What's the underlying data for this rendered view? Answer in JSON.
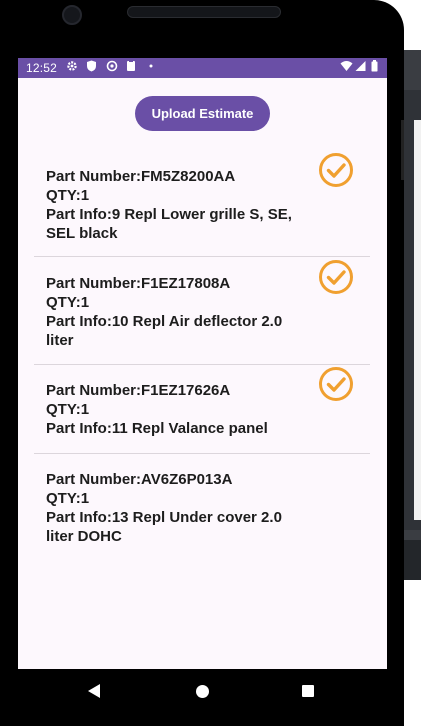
{
  "status_bar": {
    "time": "12:52",
    "icons": [
      "gear-icon",
      "shield-icon",
      "sync-icon",
      "clipboard-icon",
      "dot-icon",
      "wifi-icon",
      "signal-icon",
      "battery-icon"
    ]
  },
  "upload_button": {
    "label": "Upload Estimate"
  },
  "parts": [
    {
      "number_line": "Part Number:FM5Z8200AA",
      "qty_line": "QTY:1",
      "info_line": "Part Info:9 Repl Lower grille S, SE, SEL black",
      "checked": true
    },
    {
      "number_line": "Part Number:F1EZ17808A",
      "qty_line": "QTY:1",
      "info_line": "Part Info:10 Repl Air deflector 2.0 liter",
      "checked": true
    },
    {
      "number_line": "Part Number:F1EZ17626A",
      "qty_line": "QTY:1",
      "info_line": "Part Info:11 Repl Valance panel",
      "checked": true
    },
    {
      "number_line": "Part Number:AV6Z6P013A",
      "qty_line": "QTY:1",
      "info_line": "Part Info:13 Repl Under cover 2.0 liter DOHC",
      "checked": false
    }
  ],
  "colors": {
    "accent": "#6a4fa6",
    "check": "#f0a030",
    "screen_bg": "#fdf8fd"
  },
  "nav_bar": {
    "icons": [
      "back-icon",
      "home-icon",
      "recents-icon"
    ]
  }
}
